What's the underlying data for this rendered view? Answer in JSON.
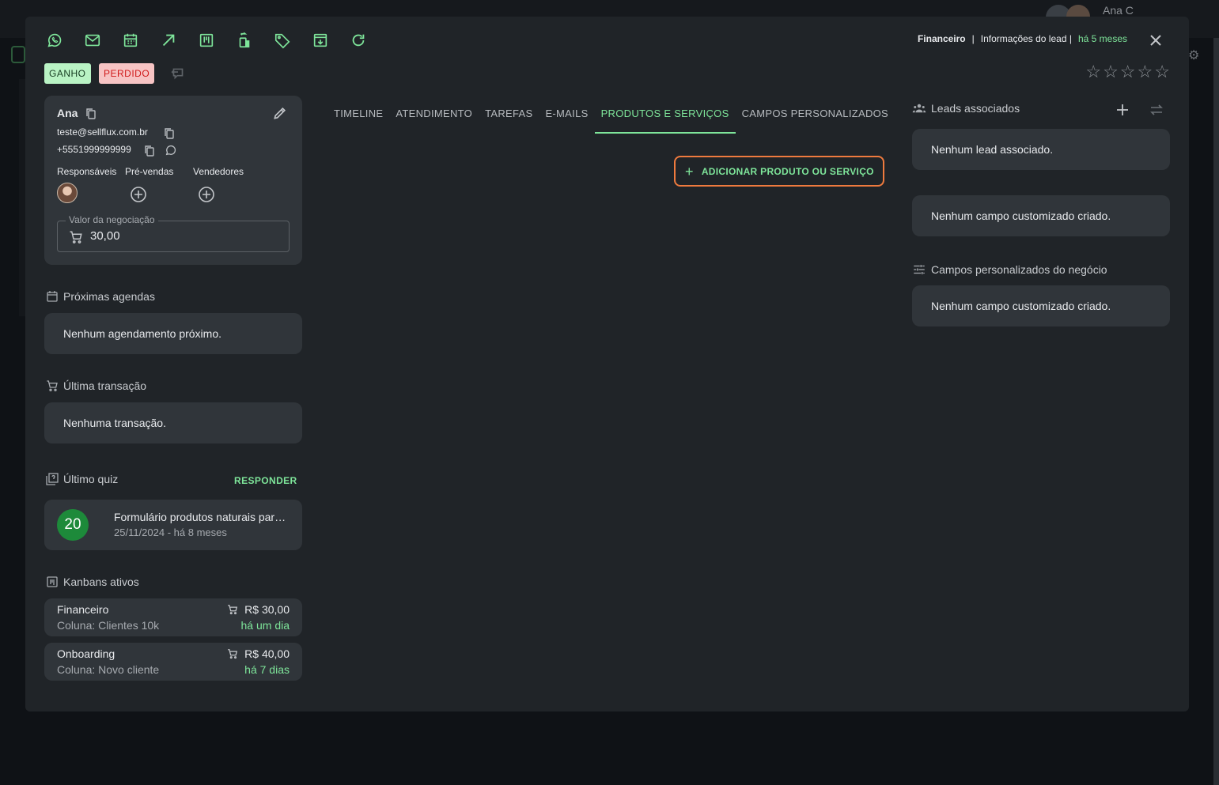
{
  "background": {
    "user_name": "Ana C"
  },
  "header": {
    "pipeline": "Financeiro",
    "separator": "|",
    "info": "Informações do lead |",
    "age": "há 5 meses"
  },
  "toolbar_icons": [
    "whatsapp-icon",
    "mail-icon",
    "calendar-icon",
    "arrow-up-right-icon",
    "kanban-icon",
    "transfer-icon",
    "tag-icon",
    "archive-icon",
    "refresh-icon"
  ],
  "status": {
    "won": "GANHO",
    "lost": "PERDIDO"
  },
  "rating": {
    "stars": 0,
    "max": 5,
    "empty_star": "☆"
  },
  "contact": {
    "name": "Ana",
    "email": "teste@sellflux.com.br",
    "phone": "+5551999999999",
    "roles": {
      "responsible": "Responsáveis",
      "presales": "Pré-vendas",
      "sellers": "Vendedores"
    },
    "deal_value_label": "Valor da negociação",
    "deal_value": "30,00"
  },
  "schedules": {
    "title": "Próximas agendas",
    "empty": "Nenhum agendamento próximo."
  },
  "transaction": {
    "title": "Última transação",
    "empty": "Nenhuma transação."
  },
  "quiz": {
    "title": "Último quiz",
    "action": "RESPONDER",
    "score": "20",
    "name": "Formulário produtos naturais para você",
    "date": "25/11/2024 - há 8 meses"
  },
  "kanbans": {
    "title": "Kanbans ativos",
    "items": [
      {
        "name": "Financeiro",
        "column": "Coluna: Clientes 10k",
        "value": "R$ 30,00",
        "when": "há um dia"
      },
      {
        "name": "Onboarding",
        "column": "Coluna: Novo cliente",
        "value": "R$ 40,00",
        "when": "há 7 dias"
      }
    ]
  },
  "tabs": [
    {
      "label": "TIMELINE",
      "active": false
    },
    {
      "label": "ATENDIMENTO",
      "active": false
    },
    {
      "label": "TAREFAS",
      "active": false
    },
    {
      "label": "E-MAILS",
      "active": false
    },
    {
      "label": "PRODUTOS E SERVIÇOS",
      "active": true
    },
    {
      "label": "CAMPOS PERSONALIZADOS",
      "active": false
    }
  ],
  "products": {
    "add_label": "ADICIONAR PRODUTO OU SERVIÇO",
    "add_icon": "+"
  },
  "right": {
    "leads_title": "Leads associados",
    "leads_empty": "Nenhum lead associado.",
    "custom_empty": "Nenhum campo customizado criado.",
    "business_title": "Campos personalizados do negócio",
    "business_empty": "Nenhum campo customizado criado."
  },
  "colors": {
    "accent": "#7ee59a",
    "won_bg": "#b9f3c4",
    "lost_bg": "#f7c4c4",
    "highlight": "#ee7a3e"
  }
}
